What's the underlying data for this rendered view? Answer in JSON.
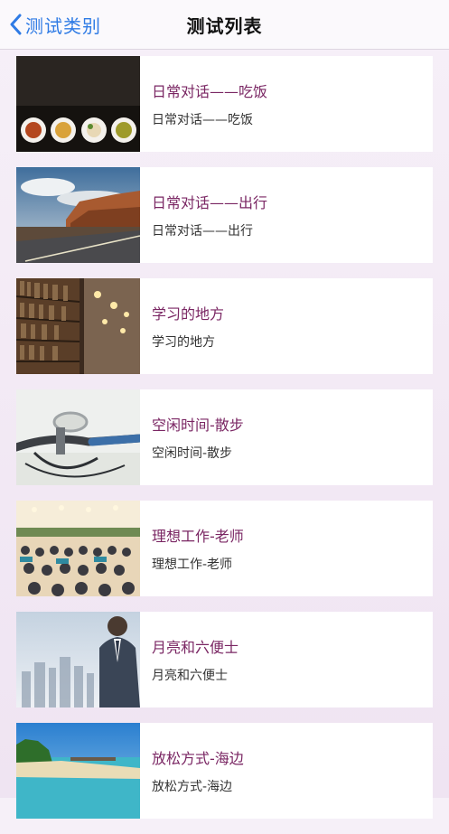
{
  "nav": {
    "back_label": "测试类别",
    "title": "测试列表"
  },
  "items": [
    {
      "title": "日常对话——吃饭",
      "subtitle": "日常对话——吃饭",
      "image": "food-plates-photo"
    },
    {
      "title": "日常对话——出行",
      "subtitle": "日常对话——出行",
      "image": "desert-road-photo"
    },
    {
      "title": "学习的地方",
      "subtitle": "学习的地方",
      "image": "library-bookshelf-photo"
    },
    {
      "title": "空闲时间-散步",
      "subtitle": "空闲时间-散步",
      "image": "bicycle-handlebar-photo"
    },
    {
      "title": "理想工作-老师",
      "subtitle": "理想工作-老师",
      "image": "conference-audience-photo"
    },
    {
      "title": "月亮和六便士",
      "subtitle": "月亮和六便士",
      "image": "businessman-city-photo"
    },
    {
      "title": "放松方式-海边",
      "subtitle": "放松方式-海边",
      "image": "beach-seaside-photo"
    }
  ]
}
